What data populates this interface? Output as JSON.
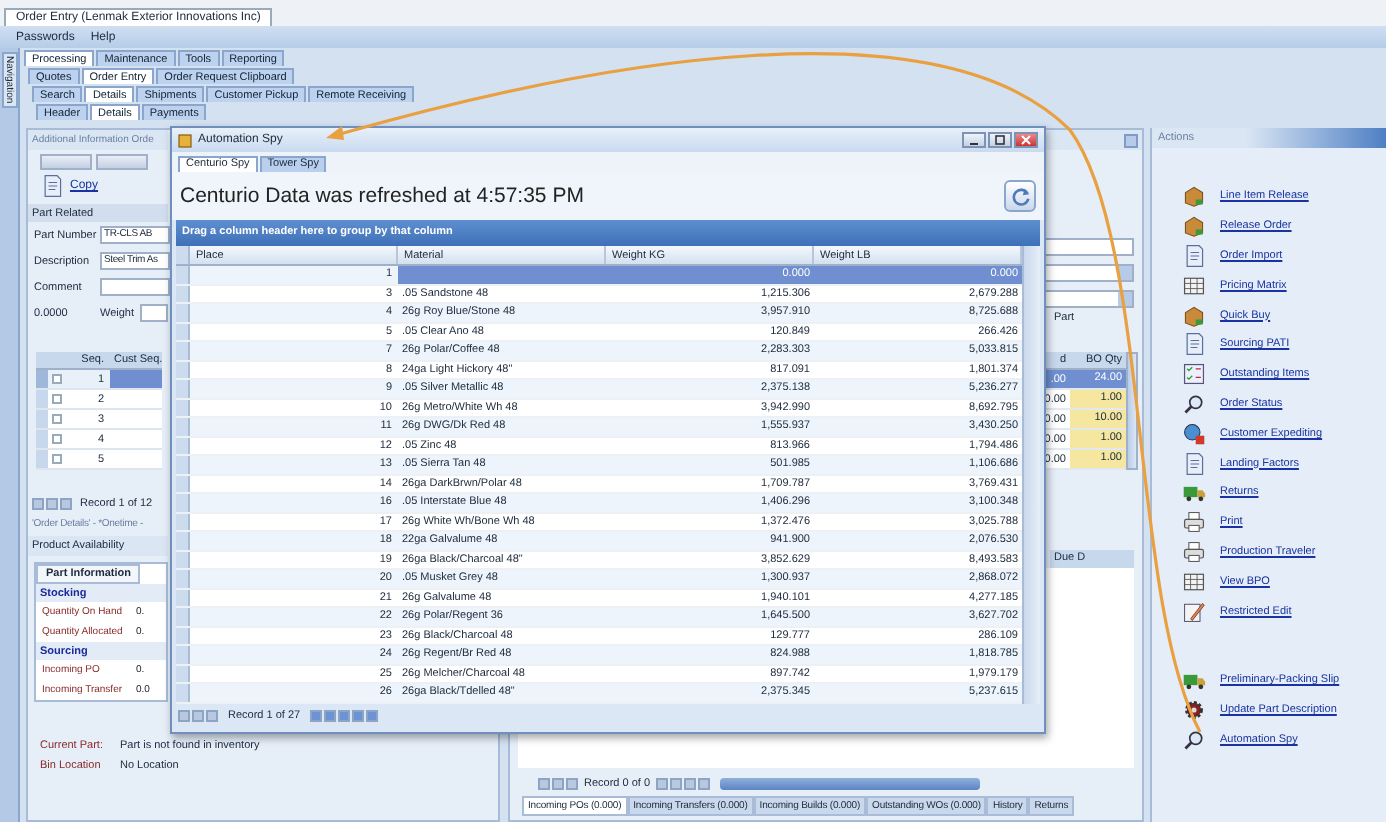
{
  "window": {
    "title": "Order Entry (Lenmak Exterior Innovations Inc)"
  },
  "menu": [
    "Passwords",
    "Help"
  ],
  "navigation_label": "Navigation",
  "tab_rows": [
    [
      {
        "label": "Processing",
        "selected": true
      },
      {
        "label": "Maintenance",
        "selected": false
      },
      {
        "label": "Tools",
        "selected": false
      },
      {
        "label": "Reporting",
        "selected": false
      }
    ],
    [
      {
        "label": "Quotes",
        "selected": false
      },
      {
        "label": "Order Entry",
        "selected": true
      },
      {
        "label": "Order Request Clipboard",
        "selected": false
      }
    ],
    [
      {
        "label": "Search",
        "selected": false
      },
      {
        "label": "Details",
        "selected": true
      },
      {
        "label": "Shipments",
        "selected": false
      },
      {
        "label": "Customer Pickup",
        "selected": false
      },
      {
        "label": "Remote Receiving",
        "selected": false
      }
    ],
    [
      {
        "label": "Header",
        "selected": false
      },
      {
        "label": "Details",
        "selected": true
      },
      {
        "label": "Payments",
        "selected": false
      }
    ]
  ],
  "left_panel": {
    "title": "Additional Information Orde",
    "copy": "Copy",
    "section": "Part Related",
    "fields": [
      {
        "label": "Part Number",
        "value": "TR-CLS AB"
      },
      {
        "label": "Description",
        "value": "Steel Trim As"
      },
      {
        "label": "Comment"
      }
    ],
    "quantity": "0.0000",
    "weight_label": "Weight",
    "seq_grid": {
      "columns": [
        "Seq.",
        "Cust Seq."
      ],
      "rows": [
        {
          "seq": "1",
          "selected": true
        },
        {
          "seq": "2",
          "selected": false
        },
        {
          "seq": "3",
          "selected": false
        },
        {
          "seq": "4",
          "selected": false
        },
        {
          "seq": "5",
          "selected": false
        }
      ]
    },
    "pager": "Record 1 of 12",
    "details_caption": "'Order Details' - *Onetime -"
  },
  "product_availability": {
    "title": "Product Availability",
    "tabs": [
      {
        "label": "Part Information",
        "selected": true
      }
    ],
    "sections": [
      {
        "title": "Stocking",
        "rows": [
          {
            "label": "Quantity On Hand",
            "value": "0."
          },
          {
            "label": "Quantity Allocated",
            "value": "0."
          }
        ]
      },
      {
        "title": "Sourcing",
        "rows": [
          {
            "label": "Incoming PO",
            "value": "0."
          },
          {
            "label": "Incoming Transfer",
            "value": "0.0"
          }
        ]
      }
    ],
    "info": [
      {
        "label": "Current Part:",
        "value": "Part is not found in inventory"
      },
      {
        "label": "Bin Location",
        "value": "No Location"
      }
    ]
  },
  "order_lines": {
    "part_label": "Part",
    "columns": [
      "d",
      "BO Qty"
    ],
    "rows": [
      {
        "column_1": ".00",
        "bo_qty": "24.00",
        "selected": true
      },
      {
        "column_1": "0.00",
        "bo_qty": "1.00",
        "selected": false
      },
      {
        "column_1": "0.00",
        "bo_qty": "10.00",
        "selected": false
      },
      {
        "column_1": "0.00",
        "bo_qty": "1.00",
        "selected": false
      },
      {
        "column_1": "0.00",
        "bo_qty": "1.00",
        "selected": false
      }
    ]
  },
  "incoming": {
    "column": "Due D",
    "pager": "Record 0 of 0",
    "tabs": [
      {
        "label": "Incoming POs (0.000)",
        "selected": true
      },
      {
        "label": "Incoming Transfers (0.000)",
        "selected": false
      },
      {
        "label": "Incoming Builds (0.000)",
        "selected": false
      },
      {
        "label": "Outstanding WOs (0.000)",
        "selected": false
      },
      {
        "label": "History",
        "selected": false
      },
      {
        "label": "Returns",
        "selected": false
      }
    ]
  },
  "actions": {
    "title": "Actions",
    "groups": [
      [
        "Line Item Release",
        "Release Order",
        "Order Import",
        "Pricing Matrix",
        "Quick Buy",
        "Sourcing PATI",
        "Outstanding Items",
        "Order Status",
        "Customer Expediting",
        "Landing Factors",
        "Returns",
        "Print",
        "Production Traveler",
        "View BPO",
        "Restricted Edit"
      ],
      [
        "Preliminary-Packing Slip",
        "Update Part Description",
        "Automation Spy"
      ]
    ]
  },
  "spy": {
    "title": "Automation Spy",
    "tabs": [
      {
        "label": "Centurio Spy",
        "selected": true
      },
      {
        "label": "Tower Spy",
        "selected": false
      }
    ],
    "status": "Centurio Data was refreshed at 4:57:35 PM",
    "group_hint": "Drag a column header here to group by that column",
    "columns": [
      "Place",
      "Material",
      "Weight KG",
      "Weight LB"
    ],
    "rows": [
      {
        "place": "1",
        "weight_kg": "0.000",
        "weight_lb": "0.000",
        "selected": true
      },
      {
        "place": "3",
        "material": ".05 Sandstone  48",
        "weight_kg": "1,215.306",
        "weight_lb": "2,679.288",
        "selected": false
      },
      {
        "place": "4",
        "material": "26g Roy Blue/Stone 48",
        "weight_kg": "3,957.910",
        "weight_lb": "8,725.688",
        "selected": false
      },
      {
        "place": "5",
        "material": ".05 Clear Ano 48",
        "weight_kg": "120.849",
        "weight_lb": "266.426",
        "selected": false
      },
      {
        "place": "7",
        "material": "26g Polar/Coffee 48",
        "weight_kg": "2,283.303",
        "weight_lb": "5,033.815",
        "selected": false
      },
      {
        "place": "8",
        "material": "24ga Light Hickory 48\"",
        "weight_kg": "817.091",
        "weight_lb": "1,801.374",
        "selected": false
      },
      {
        "place": "9",
        "material": ".05 Silver Metallic 48",
        "weight_kg": "2,375.138",
        "weight_lb": "5,236.277",
        "selected": false
      },
      {
        "place": "10",
        "material": "26g Metro/White Wh 48",
        "weight_kg": "3,942.990",
        "weight_lb": "8,692.795",
        "selected": false
      },
      {
        "place": "11",
        "material": "26g DWG/Dk Red 48",
        "weight_kg": "1,555.937",
        "weight_lb": "3,430.250",
        "selected": false
      },
      {
        "place": "12",
        "material": ".05 Zinc 48",
        "weight_kg": "813.966",
        "weight_lb": "1,794.486",
        "selected": false
      },
      {
        "place": "13",
        "material": ".05 Sierra Tan 48",
        "weight_kg": "501.985",
        "weight_lb": "1,106.686",
        "selected": false
      },
      {
        "place": "14",
        "material": "26ga DarkBrwn/Polar 48",
        "weight_kg": "1,709.787",
        "weight_lb": "3,769.431",
        "selected": false
      },
      {
        "place": "16",
        "material": ".05 Interstate Blue 48",
        "weight_kg": "1,406.296",
        "weight_lb": "3,100.348",
        "selected": false
      },
      {
        "place": "17",
        "material": "26g White Wh/Bone Wh 48",
        "weight_kg": "1,372.476",
        "weight_lb": "3,025.788",
        "selected": false
      },
      {
        "place": "18",
        "material": "22ga Galvalume 48",
        "weight_kg": "941.900",
        "weight_lb": "2,076.530",
        "selected": false
      },
      {
        "place": "19",
        "material": "26ga Black/Charcoal 48\"",
        "weight_kg": "3,852.629",
        "weight_lb": "8,493.583",
        "selected": false
      },
      {
        "place": "20",
        "material": ".05 Musket Grey 48",
        "weight_kg": "1,300.937",
        "weight_lb": "2,868.072",
        "selected": false
      },
      {
        "place": "21",
        "material": "26g Galvalume 48",
        "weight_kg": "1,940.101",
        "weight_lb": "4,277.185",
        "selected": false
      },
      {
        "place": "22",
        "material": "26g Polar/Regent 36",
        "weight_kg": "1,645.500",
        "weight_lb": "3,627.702",
        "selected": false
      },
      {
        "place": "23",
        "material": "26g Black/Charcoal 48",
        "weight_kg": "129.777",
        "weight_lb": "286.109",
        "selected": false
      },
      {
        "place": "24",
        "material": "26g Regent/Br Red 48",
        "weight_kg": "824.988",
        "weight_lb": "1,818.785",
        "selected": false
      },
      {
        "place": "25",
        "material": "26g Melcher/Charcoal 48",
        "weight_kg": "897.742",
        "weight_lb": "1,979.179",
        "selected": false
      },
      {
        "place": "26",
        "material": "26ga Black/Tdelled 48\"",
        "weight_kg": "2,375.345",
        "weight_lb": "5,237.615",
        "selected": false
      }
    ],
    "pager": "Record 1 of 27"
  }
}
